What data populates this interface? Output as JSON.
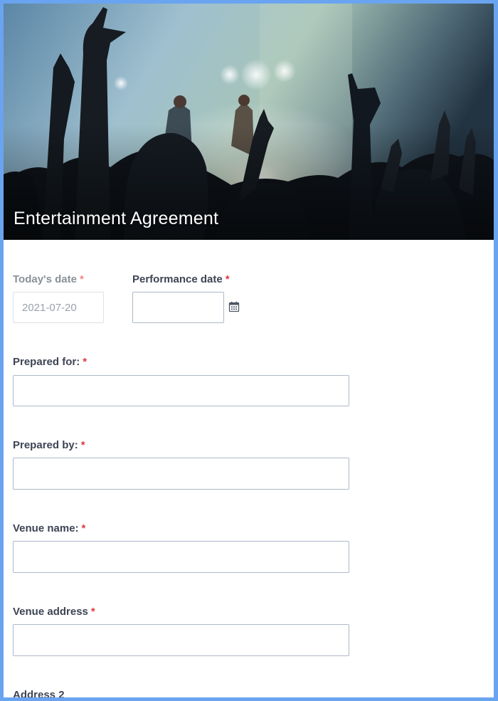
{
  "header": {
    "title": "Entertainment Agreement",
    "image": "concert-crowd-photo"
  },
  "form": {
    "todays_date": {
      "label": "Today's date",
      "required_mark": "*",
      "value": "2021-07-20"
    },
    "performance_date": {
      "label": "Performance date",
      "required_mark": "*",
      "value": "",
      "icon": "calendar-icon"
    },
    "prepared_for": {
      "label": "Prepared for:",
      "required_mark": "*",
      "value": ""
    },
    "prepared_by": {
      "label": "Prepared by:",
      "required_mark": "*",
      "value": ""
    },
    "venue_name": {
      "label": "Venue name:",
      "required_mark": "*",
      "value": ""
    },
    "venue_address": {
      "label": "Venue address",
      "required_mark": "*",
      "value": ""
    },
    "address_2": {
      "label": "Address 2"
    }
  },
  "colors": {
    "frame_border": "#6aa4f0",
    "label_text": "#3d4454",
    "required_star": "#e0393e",
    "input_border": "#aeb8c6"
  }
}
